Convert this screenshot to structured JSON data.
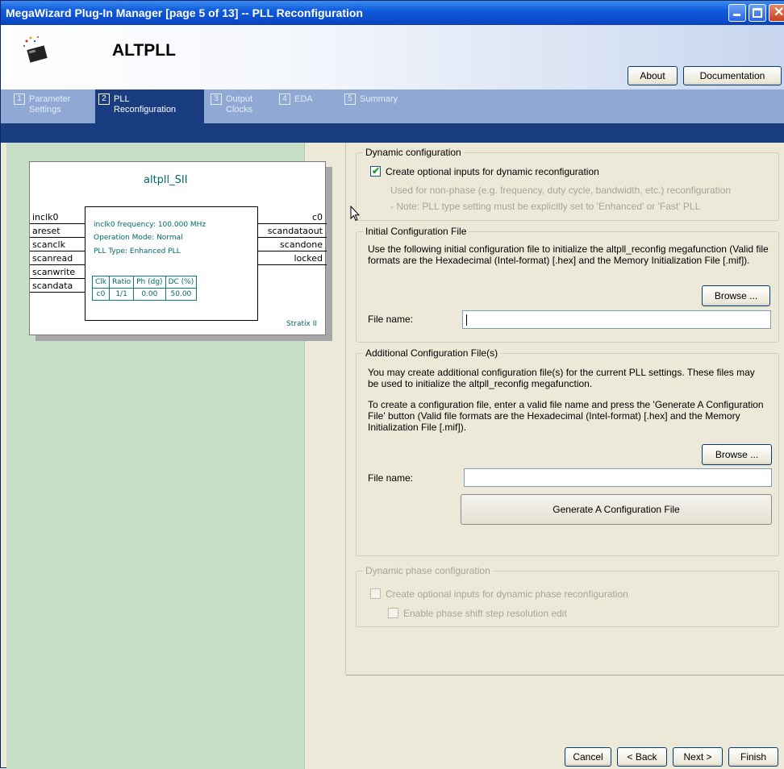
{
  "window": {
    "title": "MegaWizard Plug-In Manager [page 5 of 13] -- PLL Reconfiguration",
    "controls": {
      "minimize_icon": "minimize-icon",
      "maximize_icon": "maximize-icon",
      "close_icon": "close-icon"
    }
  },
  "header": {
    "app_name": "ALTPLL",
    "about_label": "About",
    "documentation_label": "Documentation"
  },
  "tabs": [
    {
      "num": "1",
      "label": "Parameter\nSettings",
      "active": false
    },
    {
      "num": "2",
      "label": "PLL\nReconfiguration",
      "active": true
    },
    {
      "num": "3",
      "label": "Output\nClocks",
      "active": false
    },
    {
      "num": "4",
      "label": "EDA",
      "active": false
    },
    {
      "num": "5",
      "label": "Summary",
      "active": false
    }
  ],
  "diagram": {
    "title": "altpll_SII",
    "inputs": [
      "inclk0",
      "areset",
      "scanclk",
      "scanread",
      "scanwrite",
      "scandata"
    ],
    "outputs": [
      "c0",
      "scandataout",
      "scandone",
      "locked"
    ],
    "info": [
      "inclk0 frequency: 100.000 MHz",
      "Operation Mode: Normal",
      "PLL Type: Enhanced PLL"
    ],
    "table": {
      "headers": [
        "Clk",
        "Ratio",
        "Ph (dg)",
        "DC (%)"
      ],
      "rows": [
        [
          "c0",
          "1/1",
          "0.00",
          "50.00"
        ]
      ]
    },
    "family": "Stratix II"
  },
  "dynamic": {
    "group_title": "Dynamic configuration",
    "checkbox_label": "Create optional inputs for dynamic reconfiguration",
    "checked": true,
    "note1": "Used for non-phase (e.g. frequency, duty cycle, bandwidth, etc.) reconfiguration",
    "note2": "- Note: PLL type setting must be explicitly set to 'Enhanced' or 'Fast' PLL"
  },
  "initial": {
    "group_title": "Initial Configuration File",
    "desc": "Use the following initial configuration file to initialize the altpll_reconfig megafunction (Valid file formats are the Hexadecimal (Intel-format) [.hex] and the Memory Initialization File [.mif]).",
    "browse_label": "Browse ...",
    "file_label": "File name:",
    "file_value": ""
  },
  "additional": {
    "group_title": "Additional Configuration File(s)",
    "desc1": "You may create additional configuration file(s) for the current PLL settings. These files may be used to initialize the altpll_reconfig megafunction.",
    "desc2": "To create a configuration file, enter a valid file name and press the 'Generate A Configuration File' button (Valid file formats are the Hexadecimal (Intel-format) [.hex] and the Memory Initialization File [.mif]).",
    "browse_label": "Browse ...",
    "file_label": "File name:",
    "file_value": "",
    "generate_label": "Generate A Configuration File"
  },
  "phase": {
    "group_title": "Dynamic phase configuration",
    "checkbox1_label": "Create optional inputs for dynamic phase reconfiguration",
    "checkbox2_label": "Enable phase shift step resolution edit",
    "checked1": false,
    "checked2": false
  },
  "footer": {
    "cancel_label": "Cancel",
    "back_label": "< Back",
    "next_label": "Next >",
    "finish_label": "Finish"
  }
}
